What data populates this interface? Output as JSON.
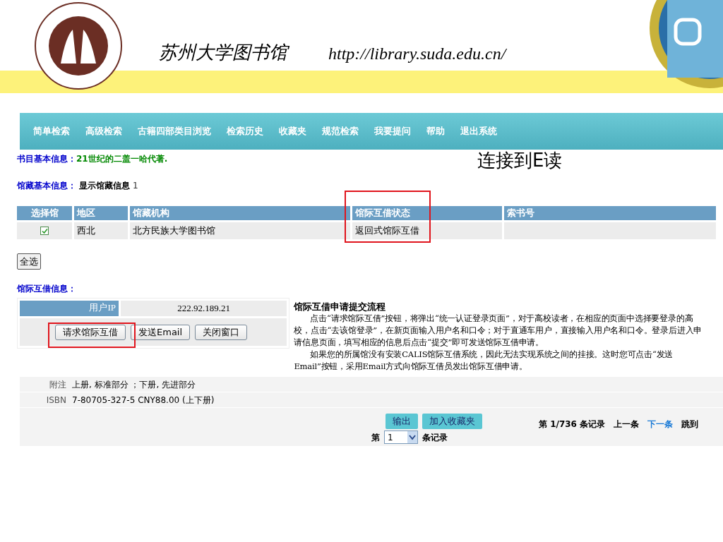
{
  "header": {
    "title": "苏州大学图书馆",
    "url": "http://library.suda.edu.cn/"
  },
  "nav": [
    "简单检索",
    "高级检索",
    "古籍四部类目浏览",
    "检索历史",
    "收藏夹",
    "规范检索",
    "我要提问",
    "帮助",
    "退出系统"
  ],
  "overlay_text": "连接到E读",
  "book_info": {
    "label": "书目基本信息：",
    "value": "21世纪的二盖一哈代著."
  },
  "holding_info": {
    "label": "馆藏基本信息：",
    "value": "显示馆藏信息",
    "count": "1"
  },
  "table": {
    "columns": [
      "选择馆",
      "地区",
      "馆藏机构",
      "馆际互借状态",
      "索书号"
    ],
    "rows": [
      {
        "checked": true,
        "region": "西北",
        "library": "北方民族大学图书馆",
        "status": "返回式馆际互借",
        "callno": ""
      }
    ]
  },
  "select_all": "全选",
  "ill_info": {
    "label": "馆际互借信息：",
    "ip_label": "用户IP",
    "ip": "222.92.189.21",
    "buttons": [
      "请求馆际互借",
      "发送Email",
      "关闭窗口"
    ]
  },
  "process": {
    "title": "馆际互借申请提交流程",
    "paragraphs": [
      "点击“请求馆际互借”按钮，将弹出“统一认证登录页面”，对于高校读者，在相应的页面中选择要登录的高校，点击“去该馆登录”，在新页面输入用户名和口令；对于直通车用户，直接输入用户名和口令。登录后进入申请信息页面，填写相应的信息后点击“提交”即可发送馆际互借申请。",
      "如果您的所属馆没有安装CALIS馆际互借系统，因此无法实现系统之间的挂接。这时您可点击“发送Email”按钮，采用Email方式向馆际互借员发出馆际互借申请。"
    ]
  },
  "details": [
    {
      "label": "附注",
      "value": "上册, 标准部分 ；下册, 先进部分"
    },
    {
      "label": "ISBN",
      "value": "7-80705-327-5 CNY88.00 (上下册)"
    }
  ],
  "actions": [
    "输出",
    "加入收藏夹"
  ],
  "pager": {
    "record": "第 1/736 条记录",
    "prev": "上一条",
    "next": "下一条",
    "jump": "跳到",
    "goto_prefix": "第",
    "goto_value": "1",
    "goto_suffix": "条记录"
  }
}
